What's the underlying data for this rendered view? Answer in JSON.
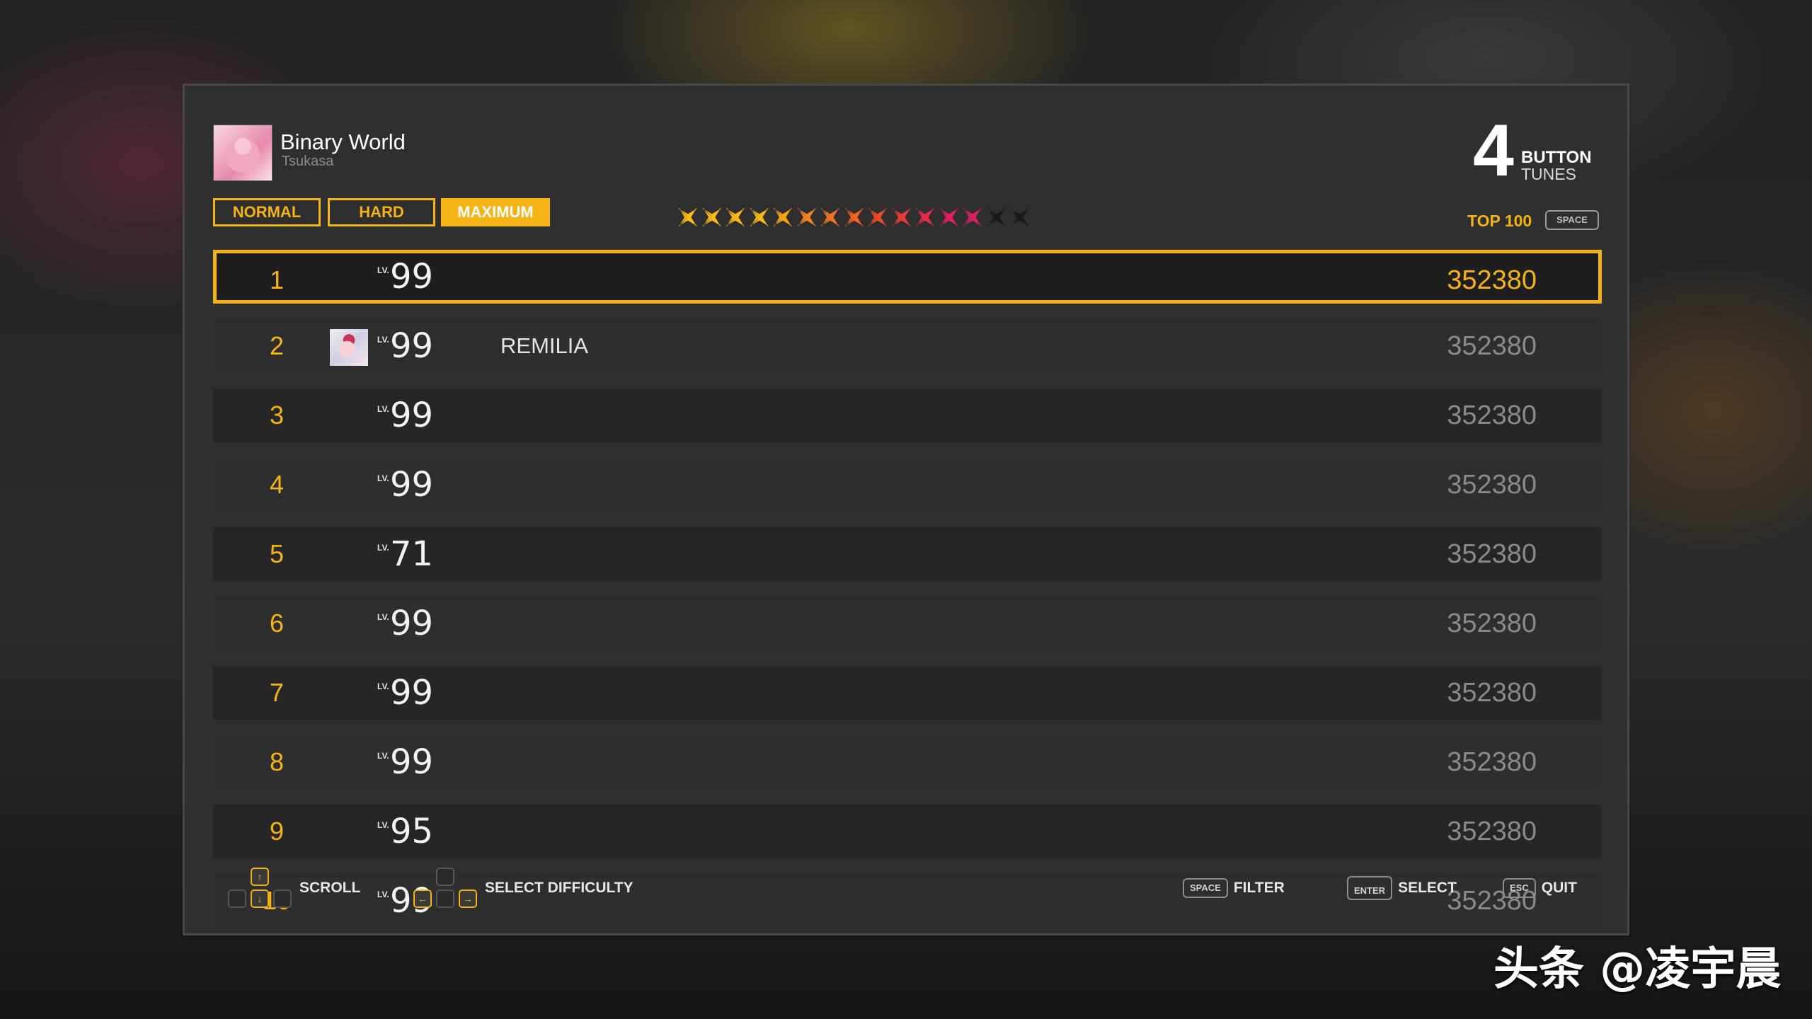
{
  "song": {
    "title": "Binary World",
    "artist": "Tsukasa"
  },
  "logo": {
    "number": "4",
    "line1": "BUTTON",
    "line2": "TUNES"
  },
  "difficulty_tabs": [
    {
      "label": "NORMAL",
      "active": false
    },
    {
      "label": "HARD",
      "active": false
    },
    {
      "label": "MAXIMUM",
      "active": true
    }
  ],
  "difficulty_stars": {
    "total": 15,
    "colors": [
      "#f6b915",
      "#f6b915",
      "#f6b915",
      "#f6b915",
      "#f6a515",
      "#f38420",
      "#f27422",
      "#f2631f",
      "#ef4b2a",
      "#ee3a37",
      "#ea2a4a",
      "#e51f5a",
      "#de1d6a",
      "#1a1a1a",
      "#1a1a1a"
    ]
  },
  "ranking": {
    "label": "TOP 100",
    "key": "SPACE"
  },
  "rows": [
    {
      "rank": "1",
      "lv_badge": "LV.",
      "level": "99",
      "player": "",
      "score": "352380",
      "has_avatar": false,
      "selected": true
    },
    {
      "rank": "2",
      "lv_badge": "LV.",
      "level": "99",
      "player": "REMILIA",
      "score": "352380",
      "has_avatar": true,
      "selected": false
    },
    {
      "rank": "3",
      "lv_badge": "LV.",
      "level": "99",
      "player": "",
      "score": "352380",
      "has_avatar": false,
      "selected": false
    },
    {
      "rank": "4",
      "lv_badge": "LV.",
      "level": "99",
      "player": "",
      "score": "352380",
      "has_avatar": false,
      "selected": false
    },
    {
      "rank": "5",
      "lv_badge": "LV.",
      "level": "71",
      "player": "",
      "score": "352380",
      "has_avatar": false,
      "selected": false
    },
    {
      "rank": "6",
      "lv_badge": "LV.",
      "level": "99",
      "player": "",
      "score": "352380",
      "has_avatar": false,
      "selected": false
    },
    {
      "rank": "7",
      "lv_badge": "LV.",
      "level": "99",
      "player": "",
      "score": "352380",
      "has_avatar": false,
      "selected": false
    },
    {
      "rank": "8",
      "lv_badge": "LV.",
      "level": "99",
      "player": "",
      "score": "352380",
      "has_avatar": false,
      "selected": false
    },
    {
      "rank": "9",
      "lv_badge": "LV.",
      "level": "95",
      "player": "",
      "score": "352380",
      "has_avatar": false,
      "selected": false
    },
    {
      "rank": "10",
      "lv_badge": "LV.",
      "level": "99",
      "player": "",
      "score": "352380",
      "has_avatar": false,
      "selected": false
    }
  ],
  "footer": {
    "scroll": {
      "label": "SCROLL",
      "up": "↑",
      "down": "↓"
    },
    "select_difficulty": {
      "label": "SELECT DIFFICULTY",
      "left": "←",
      "right": "→"
    },
    "filter": {
      "key": "SPACE",
      "label": "FILTER"
    },
    "select": {
      "key": "ENTER",
      "label": "SELECT"
    },
    "quit": {
      "key": "ESC",
      "label": "QUIT"
    }
  },
  "watermark": "头条 @凌宇晨",
  "colors": {
    "accent": "#f5b316",
    "panel": "#2f2f2f"
  }
}
